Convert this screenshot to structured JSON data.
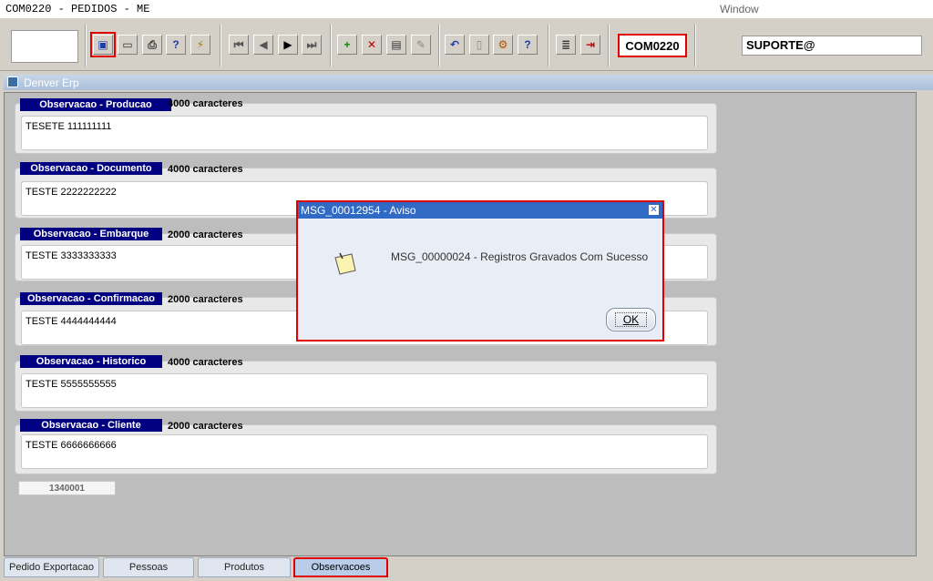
{
  "window": {
    "title": "COM0220 - PEDIDOS - ME",
    "menu_window": "Window"
  },
  "toolbar": {
    "program_code": "COM0220",
    "user": "SUPORTE@",
    "buttons": [
      {
        "name": "save-icon",
        "glyph": "▣",
        "color": "#1a3fa8"
      },
      {
        "name": "screen-icon",
        "glyph": "▭",
        "color": "#333333"
      },
      {
        "name": "print-icon",
        "glyph": "⎙",
        "color": "#333333"
      },
      {
        "name": "query-icon",
        "glyph": "?",
        "color": "#1a3fa8"
      },
      {
        "name": "execute-query-icon",
        "glyph": "⚡",
        "color": "#a08000"
      },
      {
        "name": "first-record-icon",
        "glyph": "⏮",
        "color": "#555555"
      },
      {
        "name": "previous-record-icon",
        "glyph": "◀",
        "color": "#555555"
      },
      {
        "name": "next-record-icon",
        "glyph": "▶",
        "color": "#000000"
      },
      {
        "name": "last-record-icon",
        "glyph": "⏭",
        "color": "#555555"
      },
      {
        "name": "insert-record-icon",
        "glyph": "+",
        "color": "#0a8a0a"
      },
      {
        "name": "delete-record-icon",
        "glyph": "✕",
        "color": "#c00000"
      },
      {
        "name": "lov-icon",
        "glyph": "▤",
        "color": "#333333"
      },
      {
        "name": "edit-icon",
        "glyph": "✎",
        "color": "#888888"
      },
      {
        "name": "undo-icon",
        "glyph": "↶",
        "color": "#1a3fa8"
      },
      {
        "name": "clipboard-icon",
        "glyph": "▯",
        "color": "#888888"
      },
      {
        "name": "settings-icon",
        "glyph": "⚙",
        "color": "#b05000"
      },
      {
        "name": "help-icon",
        "glyph": "?",
        "color": "#1a3fa8"
      },
      {
        "name": "menu-icon",
        "glyph": "≣",
        "color": "#333333"
      },
      {
        "name": "exit-icon",
        "glyph": "⇥",
        "color": "#c00000"
      }
    ]
  },
  "workspace": {
    "title": "Denver Erp"
  },
  "observacoes": [
    {
      "label": "Observacao - Producao",
      "count": "4000 caracteres",
      "text": "TESETE 111111111"
    },
    {
      "label": "Observacao - Documento",
      "count": "4000 caracteres",
      "text": "TESTE 2222222222"
    },
    {
      "label": "Observacao - Embarque",
      "count": "2000 caracteres",
      "text": "TESTE 3333333333"
    },
    {
      "label": "Observacao - Confirmacao",
      "count": "2000 caracteres",
      "text": "TESTE 4444444444"
    },
    {
      "label": "Observacao - Historico",
      "count": "4000 caracteres",
      "text": "TESTE 5555555555"
    },
    {
      "label": "Observacao - Cliente",
      "count": "2000 caracteres",
      "text": "TESTE 6666666666"
    }
  ],
  "record": {
    "number": "1340001"
  },
  "tabs": [
    {
      "label": "Pedido Exportacao",
      "active": false
    },
    {
      "label": "Pessoas",
      "active": false
    },
    {
      "label": "Produtos",
      "active": false
    },
    {
      "label": "Observacoes",
      "active": true
    }
  ],
  "dialog": {
    "title": "MSG_00012954 - Aviso",
    "message": "MSG_00000024 - Registros Gravados Com Sucesso",
    "ok_label": "OK",
    "close_glyph": "✕"
  }
}
